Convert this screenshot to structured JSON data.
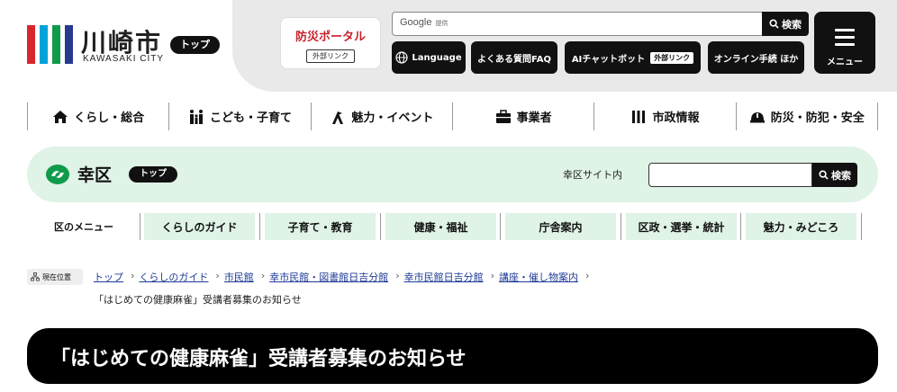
{
  "header": {
    "logo_text": "川崎市",
    "logo_sub": "KAWASAKI CITY",
    "top_pill": "トップ",
    "bosai_portal": "防災ポータル",
    "external_link": "外部リンク",
    "search_brand": "Google",
    "search_brand_sub": "提供",
    "search_button": "検索",
    "language_button": "Language",
    "faq_button": "よくある質問FAQ",
    "ai_chat_button": "AIチャットボット",
    "online_button": "オンライン手続 ほか",
    "menu_button": "メニュー",
    "logo_colors": [
      "#d9262e",
      "#00a3d9",
      "#0f9b4a",
      "#28398f"
    ]
  },
  "global_nav": [
    {
      "label": "くらし・総合",
      "icon": "house-icon"
    },
    {
      "label": "こども・子育て",
      "icon": "family-icon"
    },
    {
      "label": "魅力・イベント",
      "icon": "flag-icon"
    },
    {
      "label": "事業者",
      "icon": "briefcase-icon"
    },
    {
      "label": "市政情報",
      "icon": "bars-icon"
    },
    {
      "label": "防災・防犯・安全",
      "icon": "helmet-icon"
    }
  ],
  "ward": {
    "name": "幸区",
    "top_pill": "トップ",
    "search_label": "幸区サイト内",
    "search_button": "検索",
    "accent": "#0f9b4a"
  },
  "ward_menu": {
    "label": "区のメニュー",
    "items": [
      "くらしのガイド",
      "子育て・教育",
      "健康・福祉",
      "庁舎案内",
      "区政・選挙・統計",
      "魅力・みどころ"
    ]
  },
  "breadcrumb": {
    "label": "現在位置",
    "links": [
      "トップ",
      "くらしのガイド",
      "市民館",
      "幸市民館・図書館日吉分館",
      "幸市民館日吉分館",
      "講座・催し物案内"
    ],
    "current": "「はじめての健康麻雀」受講者募集のお知らせ"
  },
  "page_title": "「はじめての健康麻雀」受講者募集のお知らせ"
}
